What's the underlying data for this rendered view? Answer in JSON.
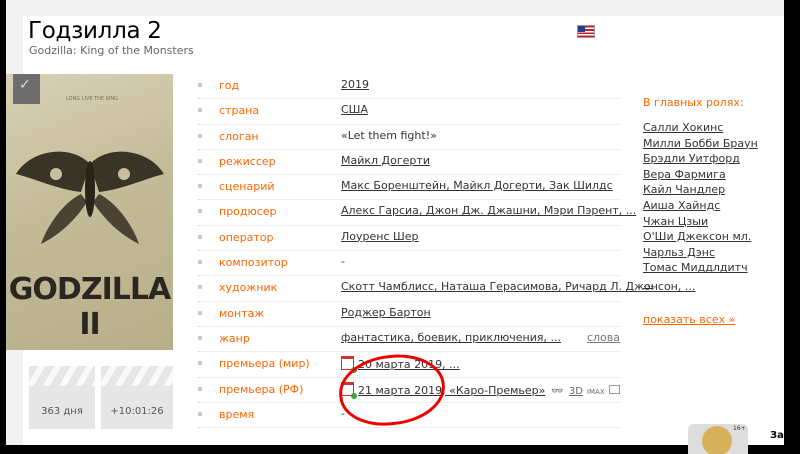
{
  "movie": {
    "title": "Годзилла 2",
    "original_title": "Godzilla: King of the Monsters"
  },
  "poster": {
    "logo_text": "GODZILLA II",
    "small_text": "LONG LIVE THE KING"
  },
  "info_rows": [
    {
      "key": "год",
      "value": "2019"
    },
    {
      "key": "страна",
      "value": "США"
    },
    {
      "key": "слоган",
      "value": "«Let them fight!»"
    },
    {
      "key": "режиссер",
      "value": "Майкл Догерти"
    },
    {
      "key": "сценарий",
      "value": "Макс Боренштейн, Майкл Догерти, Зак Шилдс"
    },
    {
      "key": "продюсер",
      "value": "Алекс Гарсиа, Джон Дж. Джашни, Мэри Пэрент, ..."
    },
    {
      "key": "оператор",
      "value": "Лоуренс Шер"
    },
    {
      "key": "композитор",
      "value": "-"
    },
    {
      "key": "художник",
      "value": "Скотт Чамблисс, Наташа Герасимова, Ричард Л. Джонсон, ..."
    },
    {
      "key": "монтаж",
      "value": "Роджер Бартон"
    },
    {
      "key": "жанр",
      "value": "фантастика, боевик, приключения, ...",
      "right": "слова"
    },
    {
      "key": "премьера (мир)",
      "value": "20 марта 2019, ..."
    },
    {
      "key": "премьера (РФ)",
      "value": "21 марта 2019, «Каро-Премьер»",
      "extra_3d": "3D",
      "extra_imax": "IMAX"
    },
    {
      "key": "время",
      "value": "-"
    }
  ],
  "cast": {
    "heading": "В главных ролях:",
    "actors": [
      "Салли Хокинс",
      "Милли Бобби Браун",
      "Брэдли Уитфорд",
      "Вера Фармига",
      "Кайл Чандлер",
      "Аиша Хайндс",
      "Чжан Цзыи",
      "О'Ши Джексон мл.",
      "Чарльз Дэнс",
      "Томас Миддлдитч",
      "..."
    ],
    "more_link": "показать всех »"
  },
  "countdown": {
    "days": "363 дня",
    "time": "+10:01:26"
  },
  "footer": {
    "age_badge": "16+",
    "cut_text": "Зап"
  },
  "colors": {
    "accent": "#ff6600",
    "annotation_red": "#ee0000"
  }
}
